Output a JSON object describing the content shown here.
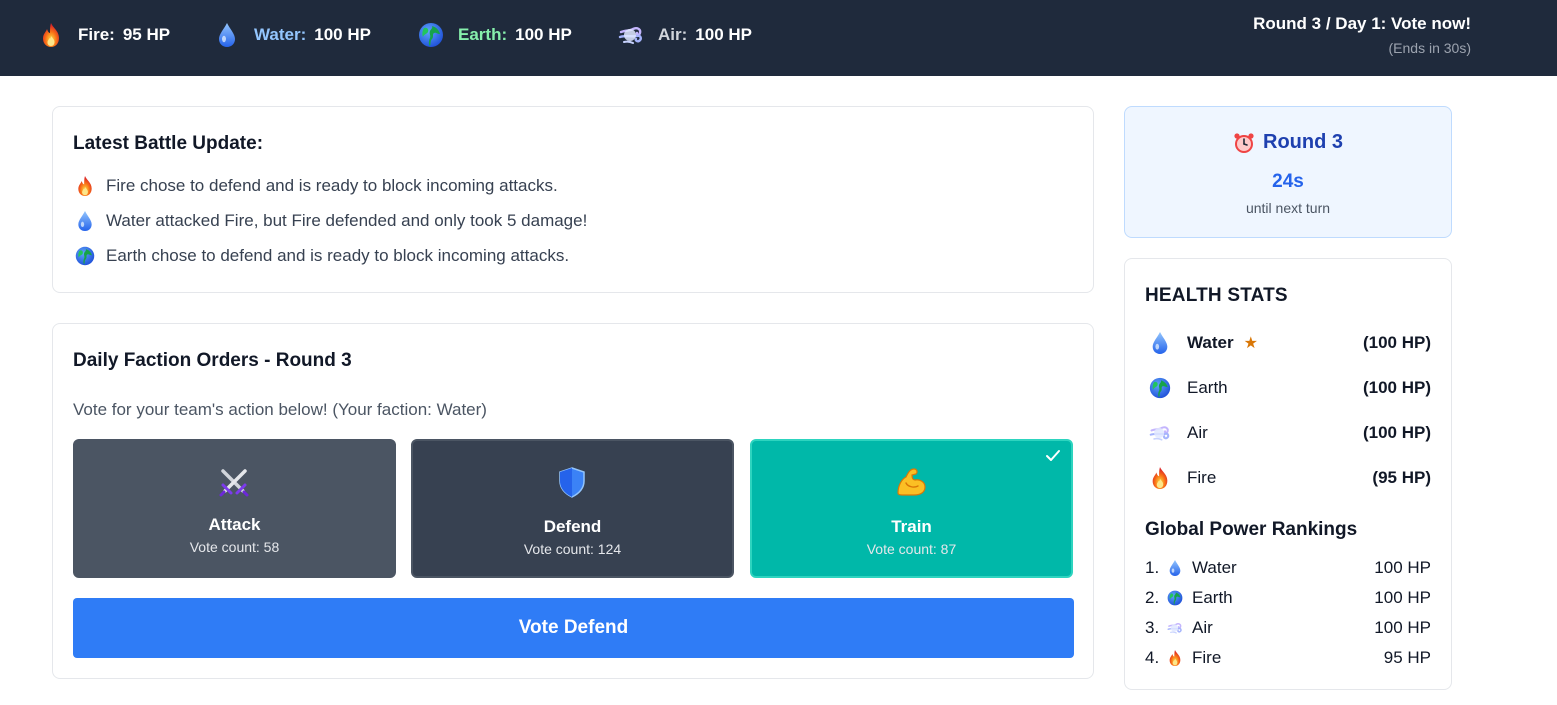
{
  "factions_bar": [
    {
      "icon": "fire-icon",
      "name": "Fire:",
      "hp": "95 HP",
      "color": "#ffffff"
    },
    {
      "icon": "water-drop-icon",
      "name": "Water:",
      "hp": "100 HP",
      "color": "#93c5fd"
    },
    {
      "icon": "earth-globe-icon",
      "name": "Earth:",
      "hp": "100 HP",
      "color": "#86efac"
    },
    {
      "icon": "air-wind-icon",
      "name": "Air:",
      "hp": "100 HP",
      "color": "#d1d5db"
    }
  ],
  "round_status": {
    "title": "Round 3 / Day 1: Vote now!",
    "subtitle": "(Ends in 30s)"
  },
  "battle_update": {
    "title": "Latest Battle Update:",
    "lines": [
      {
        "icon": "fire-icon",
        "text": "Fire chose to defend and is ready to block incoming attacks."
      },
      {
        "icon": "water-drop-icon",
        "text": "Water attacked Fire, but Fire defended and only took 5 damage!"
      },
      {
        "icon": "earth-globe-icon",
        "text": "Earth chose to defend and is ready to block incoming attacks."
      }
    ]
  },
  "orders": {
    "title": "Daily Faction Orders - Round 3",
    "description": "Vote for your team's action below! (Your faction: Water)",
    "options": [
      {
        "icon": "crossed-swords-icon",
        "label": "Attack",
        "count": "Vote count: 58"
      },
      {
        "icon": "shield-icon",
        "label": "Defend",
        "count": "Vote count: 124"
      },
      {
        "icon": "flexed-bicep-icon",
        "label": "Train",
        "count": "Vote count: 87",
        "selected": true
      }
    ],
    "vote_button": "Vote Defend"
  },
  "timer": {
    "icon": "alarm-clock-icon",
    "title": "Round 3",
    "seconds": "24s",
    "subtitle": "until next turn"
  },
  "health_stats": {
    "title": "HEALTH STATS",
    "rows": [
      {
        "icon": "water-drop-icon",
        "name": "Water",
        "star": "★",
        "hp": "(100 HP)",
        "own_faction": true
      },
      {
        "icon": "earth-globe-icon",
        "name": "Earth",
        "hp": "(100 HP)"
      },
      {
        "icon": "air-wind-icon",
        "name": "Air",
        "hp": "(100 HP)"
      },
      {
        "icon": "fire-icon",
        "name": "Fire",
        "hp": "(95 HP)"
      }
    ]
  },
  "rankings": {
    "title": "Global Power Rankings",
    "rows": [
      {
        "rank": "1.",
        "icon": "water-drop-icon",
        "name": "Water",
        "hp": "100 HP"
      },
      {
        "rank": "2.",
        "icon": "earth-globe-icon",
        "name": "Earth",
        "hp": "100 HP"
      },
      {
        "rank": "3.",
        "icon": "air-wind-icon",
        "name": "Air",
        "hp": "100 HP"
      },
      {
        "rank": "4.",
        "icon": "fire-icon",
        "name": "Fire",
        "hp": "95 HP"
      }
    ]
  },
  "colors": {
    "topbar": "#1f2a3c",
    "attack_option": "#4b5563",
    "defend_option": "#374151",
    "train_option_selected": "#00b8a9",
    "vote_button": "#2f7cf6",
    "timer_card": "#eff6ff",
    "star": "#d97706"
  }
}
